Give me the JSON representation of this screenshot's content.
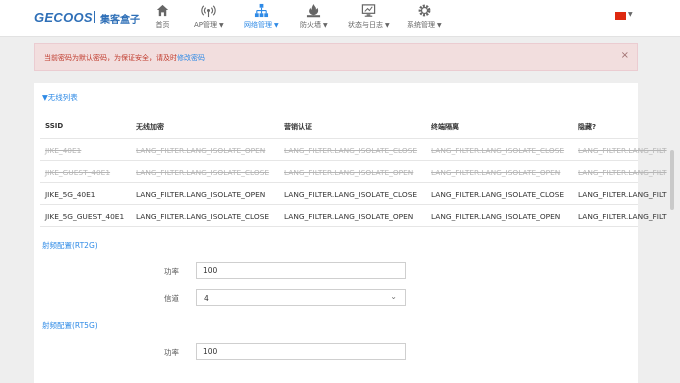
{
  "brand": {
    "logo": "GECOOS",
    "name": "集客盒子"
  },
  "nav": [
    {
      "label": "首页",
      "icon": "home-icon",
      "caret": false
    },
    {
      "label": "AP管理",
      "icon": "wifi-antenna-icon",
      "caret": true
    },
    {
      "label": "网络管理",
      "icon": "network-tree-icon",
      "caret": true
    },
    {
      "label": "防火墙",
      "icon": "firewall-icon",
      "caret": true
    },
    {
      "label": "状态与日志",
      "icon": "monitor-icon",
      "caret": true
    },
    {
      "label": "系统管理",
      "icon": "gear-icon",
      "caret": true
    }
  ],
  "alert": {
    "text": "当前密码为默认密码，为保证安全，请及时",
    "link": "修改密码",
    "close": "×"
  },
  "wireless_list": {
    "title": "▼无线列表",
    "headers": [
      "SSID",
      "无线加密",
      "营销认证",
      "终端隔离",
      "隐藏?"
    ],
    "rows": [
      {
        "struck": true,
        "cells": [
          "JIKE_40E1",
          "LANG_FILTER.LANG_ISOLATE_OPEN",
          "LANG_FILTER.LANG_ISOLATE_CLOSE",
          "LANG_FILTER.LANG_ISOLATE_CLOSE",
          "LANG_FILTER.LANG_FILT"
        ]
      },
      {
        "struck": true,
        "cells": [
          "JIKE_GUEST_40E1",
          "LANG_FILTER.LANG_ISOLATE_CLOSE",
          "LANG_FILTER.LANG_ISOLATE_OPEN",
          "LANG_FILTER.LANG_ISOLATE_OPEN",
          "LANG_FILTER.LANG_FILT"
        ]
      },
      {
        "struck": false,
        "cells": [
          "JIKE_5G_40E1",
          "LANG_FILTER.LANG_ISOLATE_OPEN",
          "LANG_FILTER.LANG_ISOLATE_CLOSE",
          "LANG_FILTER.LANG_ISOLATE_CLOSE",
          "LANG_FILTER.LANG_FILT"
        ]
      },
      {
        "struck": false,
        "cells": [
          "JIKE_5G_GUEST_40E1",
          "LANG_FILTER.LANG_ISOLATE_CLOSE",
          "LANG_FILTER.LANG_ISOLATE_OPEN",
          "LANG_FILTER.LANG_ISOLATE_OPEN",
          "LANG_FILTER.LANG_FILT"
        ]
      }
    ]
  },
  "radio_2g": {
    "title": "射频配置(RT2G)",
    "power_label": "功率",
    "power_value": "100",
    "channel_label": "信道",
    "channel_value": "4"
  },
  "radio_5g": {
    "title": "射频配置(RT5G)",
    "power_label": "功率",
    "power_value": "100"
  },
  "colors": {
    "accent": "#2e8ae6",
    "alert_bg": "#f2dede",
    "alert_text": "#c0392b"
  }
}
